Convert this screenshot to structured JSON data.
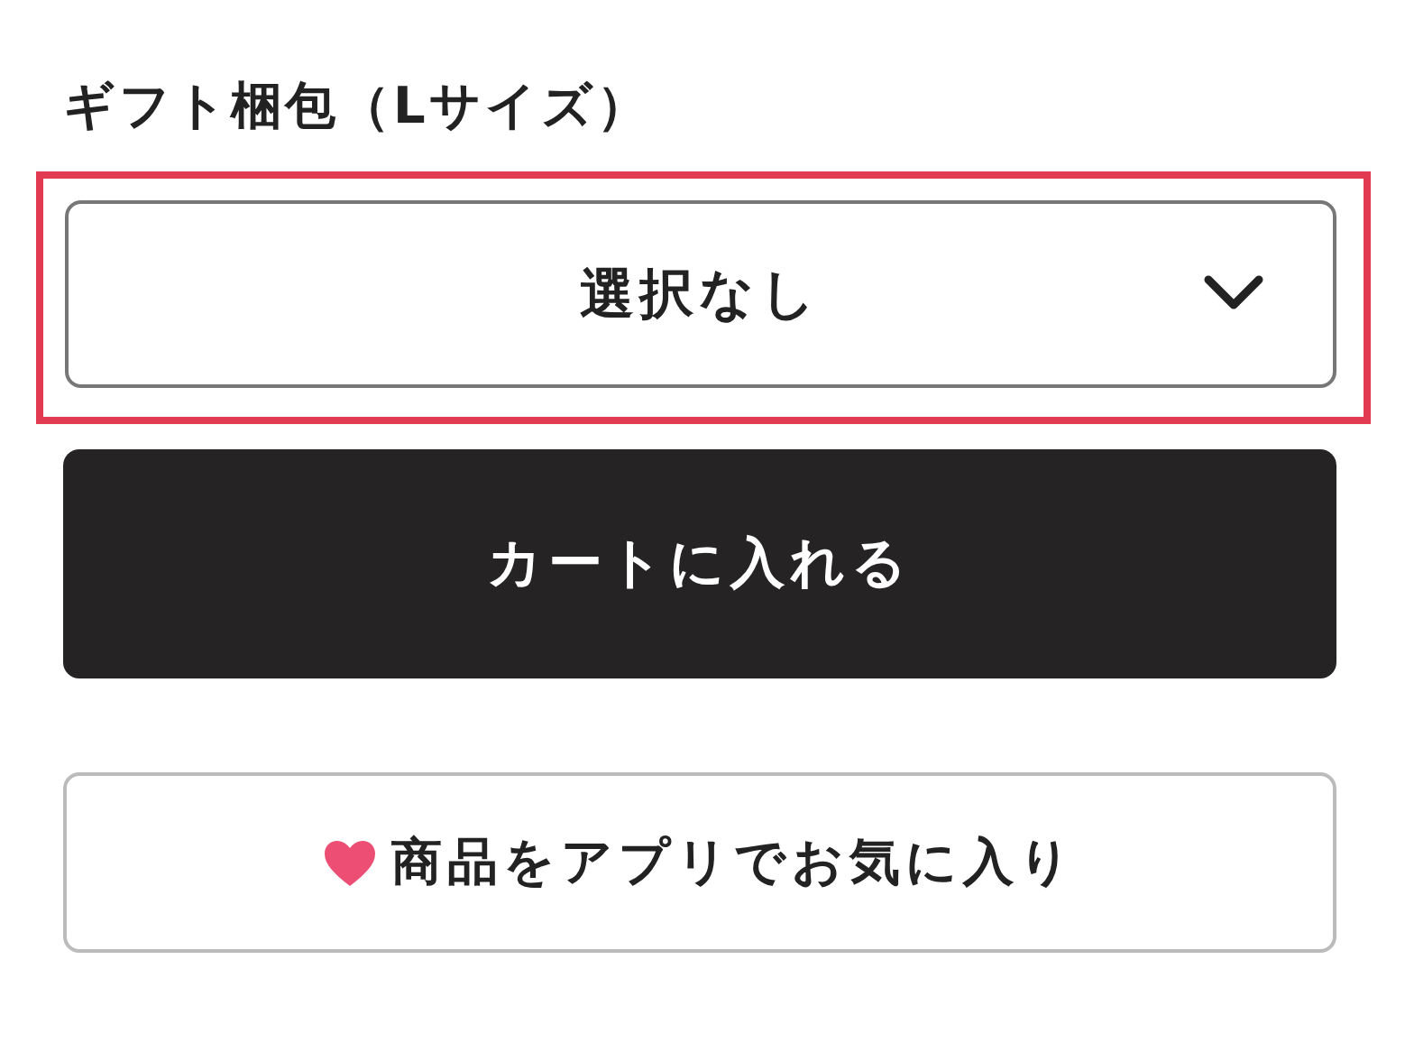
{
  "option": {
    "label": "ギフト梱包（Lサイズ）",
    "select": {
      "value": "選択なし",
      "highlighted": true
    }
  },
  "cart_button": {
    "label": "カートに入れる"
  },
  "favorite_button": {
    "label": "商品をアプリでお気に入り"
  }
}
